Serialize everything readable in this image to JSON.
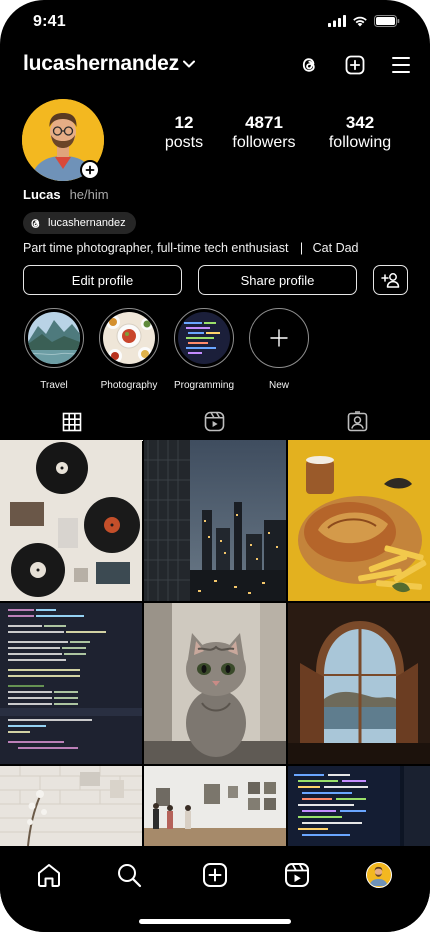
{
  "status_bar": {
    "time": "9:41"
  },
  "header": {
    "username": "lucashernandez",
    "actions": [
      "threads-icon",
      "create-icon",
      "menu-icon"
    ]
  },
  "profile": {
    "stats": [
      {
        "value": "12",
        "label": "posts"
      },
      {
        "value": "4871",
        "label": "followers"
      },
      {
        "value": "342",
        "label": "following"
      }
    ],
    "name": "Lucas",
    "pronouns": "he/him",
    "threads_handle": "lucashernandez",
    "bio": "Part time photographer, full-time tech enthusiast",
    "bio_separator": "|",
    "bio_extra": "Cat Dad"
  },
  "buttons": {
    "edit_profile": "Edit profile",
    "share_profile": "Share profile"
  },
  "highlights": [
    {
      "label": "Travel"
    },
    {
      "label": "Photography"
    },
    {
      "label": "Programming"
    },
    {
      "label": "New"
    }
  ],
  "tabs": [
    "grid-icon",
    "reels-icon",
    "tagged-icon"
  ],
  "grid_posts": [
    "vinyl-records-wall",
    "city-skyline-dusk",
    "food-platter-fries",
    "code-editor-screen",
    "kitten-portrait",
    "arched-window-sea",
    "white-wall-plant",
    "art-gallery-visitors",
    "laptop-code-dark"
  ],
  "bottom_nav": [
    "home-icon",
    "search-icon",
    "create-icon",
    "reels-icon",
    "profile-avatar"
  ],
  "colors": {
    "background": "#000000",
    "secondary_text": "#a8a8a8",
    "chip_bg": "#262626",
    "avatar_bg": "#f3b820"
  }
}
